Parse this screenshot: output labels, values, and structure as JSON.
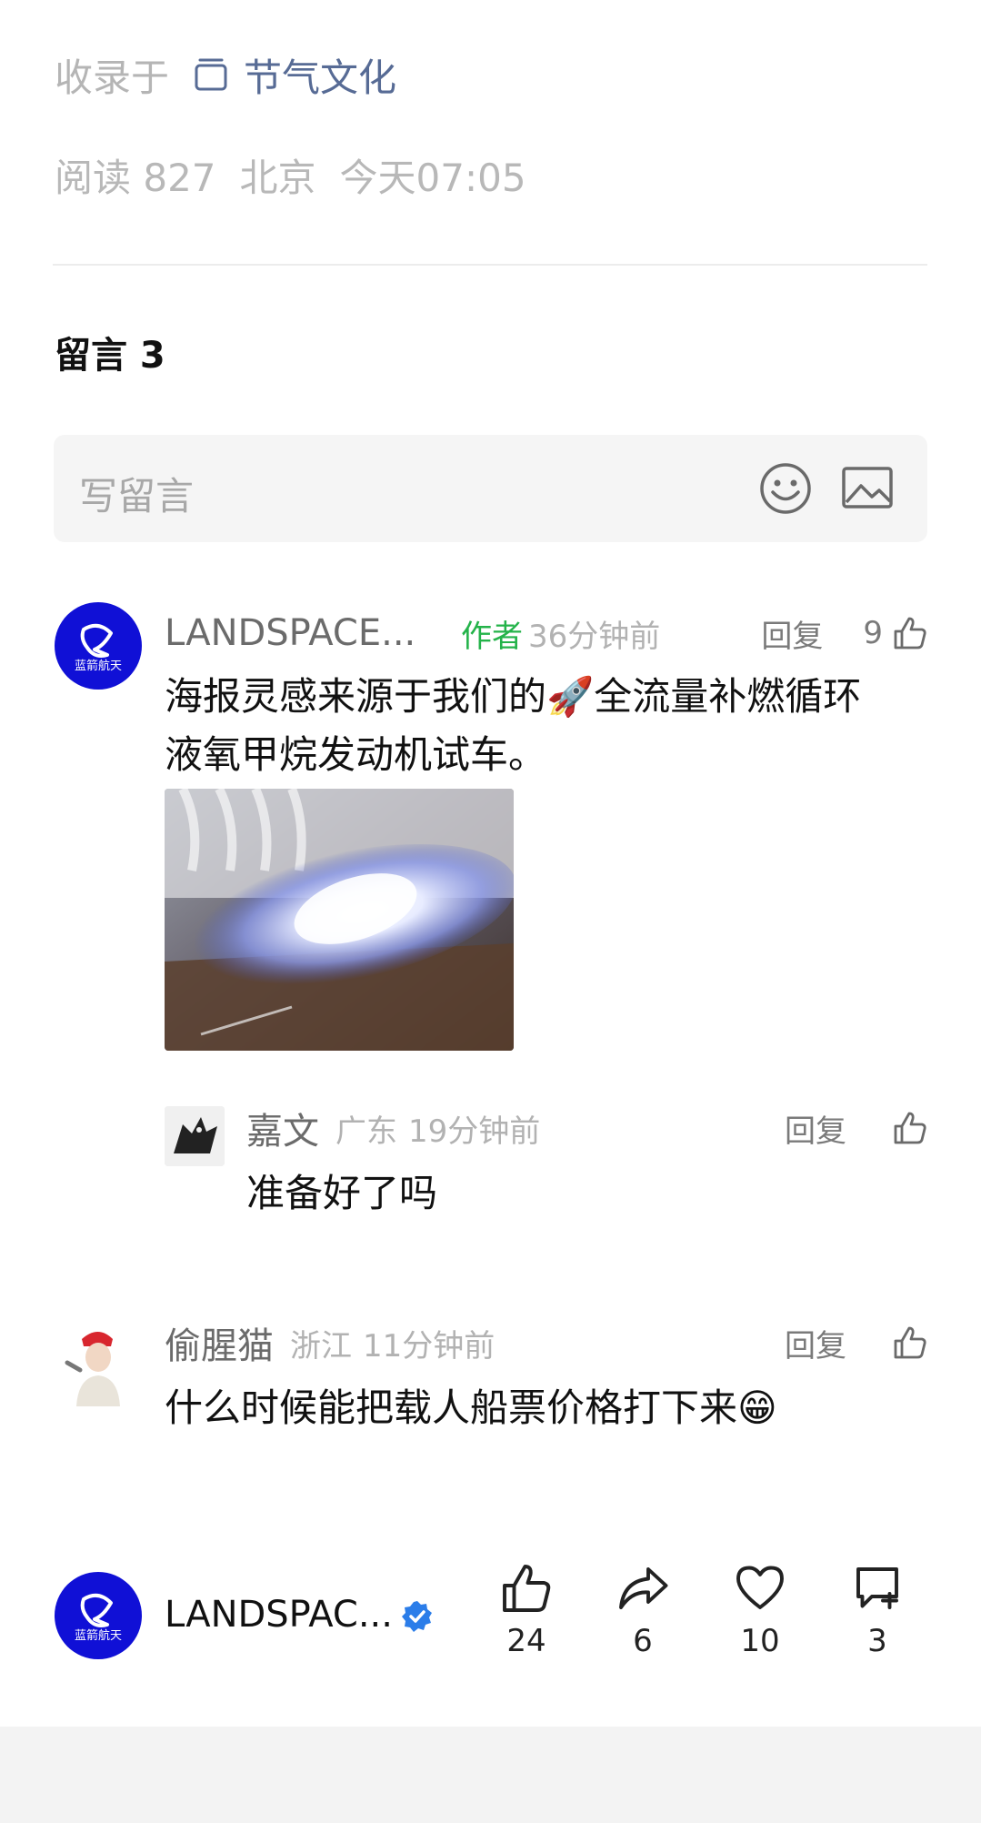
{
  "meta": {
    "collect_prefix": "收录于",
    "album": "节气文化",
    "read_label": "阅读 827",
    "location": "北京",
    "time": "今天07:05"
  },
  "comments_section": {
    "title": "留言 3",
    "input_placeholder": "写留言",
    "emoji_icon": "emoji-icon",
    "image_icon": "image-icon"
  },
  "comments": [
    {
      "name": "LANDSPACE...",
      "author_tag": "作者",
      "time": "36分钟前",
      "reply": "回复",
      "likes": "9",
      "text_line1": "海报灵感来源于我们的🚀全流量补燃循环",
      "text_line2": "液氧甲烷发动机试车。",
      "avatar_text": "蓝箭航天",
      "replies": [
        {
          "name": "嘉文",
          "location": "广东",
          "time": "19分钟前",
          "reply": "回复",
          "text": "准备好了吗"
        }
      ]
    },
    {
      "name": "偷腥猫",
      "location": "浙江",
      "time": "11分钟前",
      "reply": "回复",
      "text": "什么时候能把载人船票价格打下来😁"
    }
  ],
  "footer": {
    "account": "LANDSPAC...",
    "avatar_text": "蓝箭航天",
    "verified_icon": "verified-badge-icon",
    "actions": [
      {
        "icon": "thumbs-up-icon",
        "count": "24"
      },
      {
        "icon": "share-icon",
        "count": "6"
      },
      {
        "icon": "heart-icon",
        "count": "10"
      },
      {
        "icon": "comment-add-icon",
        "count": "3"
      }
    ]
  },
  "colors": {
    "link": "#576b95",
    "author_tag": "#24b34a",
    "brand_avatar": "#1010d6",
    "verified": "#2b7de9"
  }
}
